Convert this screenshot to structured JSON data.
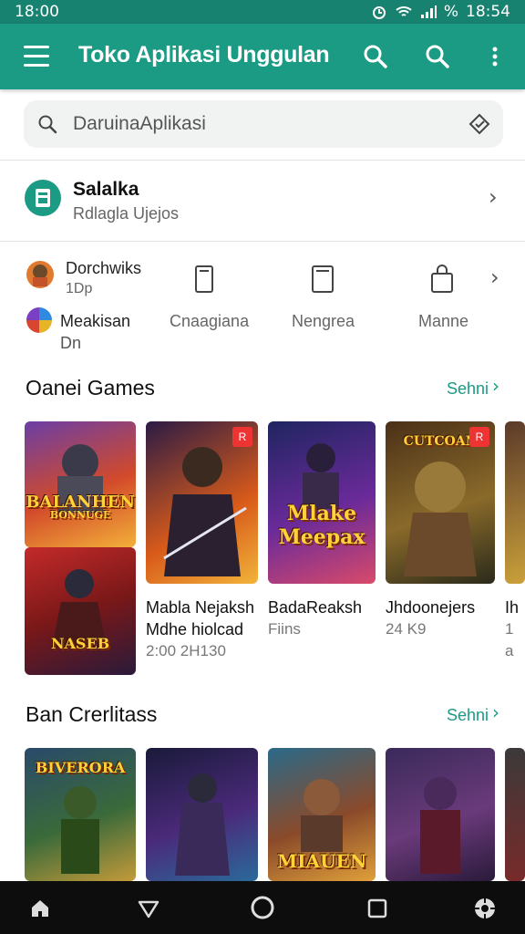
{
  "status": {
    "left_time": "18:00",
    "right_time": "18:54",
    "battery_glyph": "%"
  },
  "app_bar": {
    "title": "Toko Aplikasi Unggulan"
  },
  "search": {
    "text": "DaruinaAplikasi"
  },
  "account": {
    "title": "Salalka",
    "subtitle": "Rdlagla Ujejos"
  },
  "categories": [
    {
      "title": "Dorchwiks",
      "subtitle": "1Dp",
      "icon": "game-avatar-icon"
    },
    {
      "title": "Meakisan",
      "subtitle": "Dn",
      "icon": "colorful-circle-icon"
    },
    {
      "label": "Cnaagiana",
      "icon": "phone-icon"
    },
    {
      "label": "Nengrea",
      "icon": "tablet-icon"
    },
    {
      "label": "Manne",
      "icon": "shopping-bag-icon"
    }
  ],
  "section1": {
    "title": "Oanei Games",
    "more": "Sehni",
    "cards": [
      {
        "art": "BALANHEN",
        "art_sub": "BONNUGE"
      },
      {
        "art": "NASEB",
        "art_sub": ""
      },
      {
        "art": "",
        "badge": "R"
      },
      {
        "art": "Mlake Meepax",
        "art_sub": ""
      },
      {
        "art": "CUTCOAN",
        "badge": "R"
      },
      {
        "art": ""
      }
    ],
    "items": [
      {
        "line1": "Mabla Nejaksh",
        "line2": "Mdhe hiolcad",
        "meta": "2:00 2H130"
      },
      {
        "line1": "BadaReaksh",
        "meta": "Fiins"
      },
      {
        "line1": "Jhdoonejers",
        "meta": "24 K9"
      },
      {
        "line1": "Ih",
        "meta": "1 a"
      }
    ]
  },
  "section2": {
    "title": "Ban Crerlitass",
    "more": "Sehni",
    "cards": [
      {
        "art": "BIVERORA"
      },
      {
        "art": ""
      },
      {
        "art": "MIAUEN"
      },
      {
        "art": ""
      }
    ]
  },
  "colors": {
    "primary": "#1b9a84",
    "status": "#16826f",
    "nav": "#0d0d0d"
  },
  "nav": [
    "home-icon",
    "back-icon",
    "home-circle-icon",
    "recents-icon",
    "settings-icon"
  ]
}
